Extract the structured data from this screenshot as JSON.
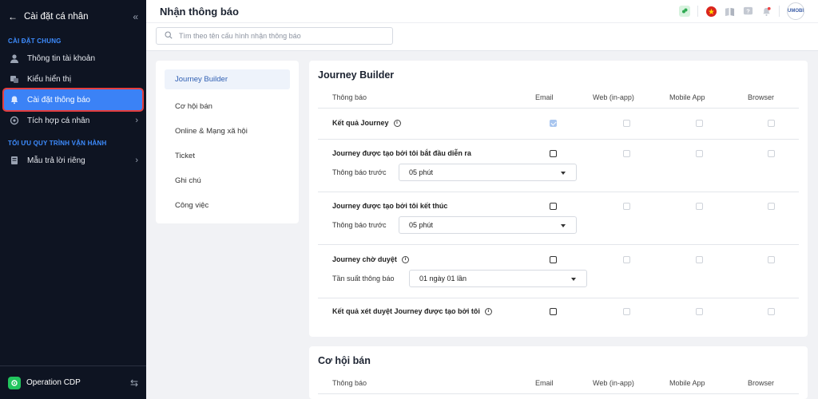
{
  "sidebar": {
    "title": "Cài đặt cá nhân",
    "back_icon": "arrow-left-icon",
    "collapse_icon": "double-chevron-left-icon",
    "sections": [
      {
        "label": "CÀI ĐẶT CHUNG"
      },
      {
        "label": "TỐI ƯU QUY TRÌNH VẬN HÀNH"
      }
    ],
    "items": [
      {
        "label": "Thông tin tài khoản",
        "icon": "user-icon"
      },
      {
        "label": "Kiểu hiển thị",
        "icon": "display-icon"
      },
      {
        "label": "Cài đặt thông báo",
        "icon": "bell-icon",
        "active": true
      },
      {
        "label": "Tích hợp cá nhân",
        "icon": "integration-icon"
      },
      {
        "label": "Mẫu trả lời riêng",
        "icon": "template-icon"
      }
    ],
    "footer": {
      "app_name": "Operation CDP",
      "icon": "app-logo-icon"
    }
  },
  "header": {
    "title": "Nhận thông báo",
    "search_placeholder": "Tìm theo tên cấu hình nhận thông báo",
    "avatar_text": "UMOBI"
  },
  "subnav": {
    "items": [
      {
        "label": "Journey Builder",
        "active": true
      },
      {
        "label": "Cơ hội bán"
      },
      {
        "label": "Online & Mạng xã hội"
      },
      {
        "label": "Ticket"
      },
      {
        "label": "Ghi chú"
      },
      {
        "label": "Công việc"
      }
    ]
  },
  "columns": {
    "notification": "Thông báo",
    "email": "Email",
    "web": "Web (in-app)",
    "mobile": "Mobile App",
    "browser": "Browser"
  },
  "journey": {
    "title": "Journey Builder",
    "rows": [
      {
        "label": "Kết quả Journey",
        "email_checked": true
      },
      {
        "label": "Journey được tạo bởi tôi bắt đầu diễn ra",
        "sub_label": "Thông báo trước",
        "select_value": "05 phút",
        "email_checked": false
      },
      {
        "label": "Journey được tạo bởi tôi kết thúc",
        "sub_label": "Thông báo trước",
        "select_value": "05 phút",
        "email_checked": false
      },
      {
        "label": "Journey chờ duyệt",
        "sub_label": "Tần suất thông báo",
        "select_value": "01 ngày 01 lần",
        "email_checked": false
      },
      {
        "label": "Kết quả xét duyệt Journey được tạo bởi tôi",
        "email_checked": false
      }
    ]
  },
  "opportunity": {
    "title": "Cơ hội bán"
  },
  "colors": {
    "sidebar_bg": "#0e1422",
    "accent": "#3b82f6",
    "highlight_border": "#e53e3e",
    "section_label": "#3d8cff"
  }
}
